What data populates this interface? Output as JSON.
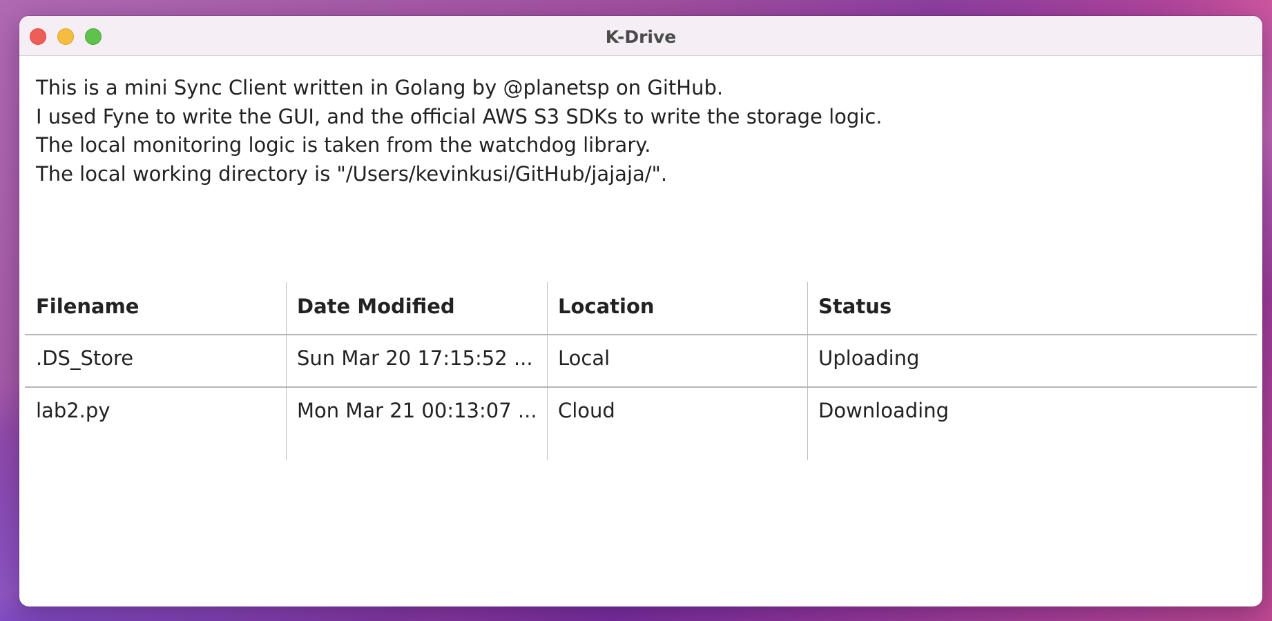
{
  "window": {
    "title": "K-Drive"
  },
  "intro": {
    "lines": [
      "This is a mini Sync Client written in Golang by @planetsp on GitHub.",
      "I used Fyne to write the GUI, and the official AWS S3 SDKs to write the storage logic.",
      "The local monitoring logic is taken from the watchdog library.",
      "The local working directory is \"/Users/kevinkusi/GitHub/jajaja/\"."
    ]
  },
  "table": {
    "columns": [
      "Filename",
      "Date Modified",
      "Location",
      "Status"
    ],
    "rows": [
      [
        ".DS_Store",
        "Sun Mar 20 17:15:52 ...",
        "Local",
        "Uploading"
      ],
      [
        "lab2.py",
        "Mon Mar 21 00:13:07 ...",
        "Cloud",
        "Downloading"
      ]
    ]
  }
}
